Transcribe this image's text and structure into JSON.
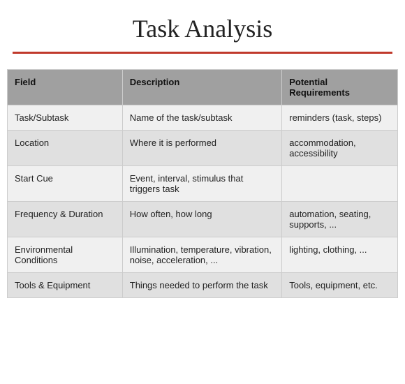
{
  "header": {
    "title": "Task Analysis"
  },
  "table": {
    "columns": [
      {
        "key": "field",
        "label": "Field"
      },
      {
        "key": "description",
        "label": "Description"
      },
      {
        "key": "requirements",
        "label": "Potential Requirements"
      }
    ],
    "rows": [
      {
        "field": "Task/Subtask",
        "description": "Name of the task/subtask",
        "requirements": "reminders (task, steps)"
      },
      {
        "field": "Location",
        "description": "Where it is performed",
        "requirements": "accommodation, accessibility"
      },
      {
        "field": "Start Cue",
        "description": "Event, interval, stimulus that triggers task",
        "requirements": ""
      },
      {
        "field": "Frequency & Duration",
        "description": "How often, how long",
        "requirements": "automation, seating, supports, ..."
      },
      {
        "field": "Environmental Conditions",
        "description": "Illumination, temperature, vibration, noise, acceleration, ...",
        "requirements": "lighting, clothing, ..."
      },
      {
        "field": "Tools & Equipment",
        "description": "Things needed to perform the task",
        "requirements": "Tools, equipment, etc."
      }
    ]
  }
}
